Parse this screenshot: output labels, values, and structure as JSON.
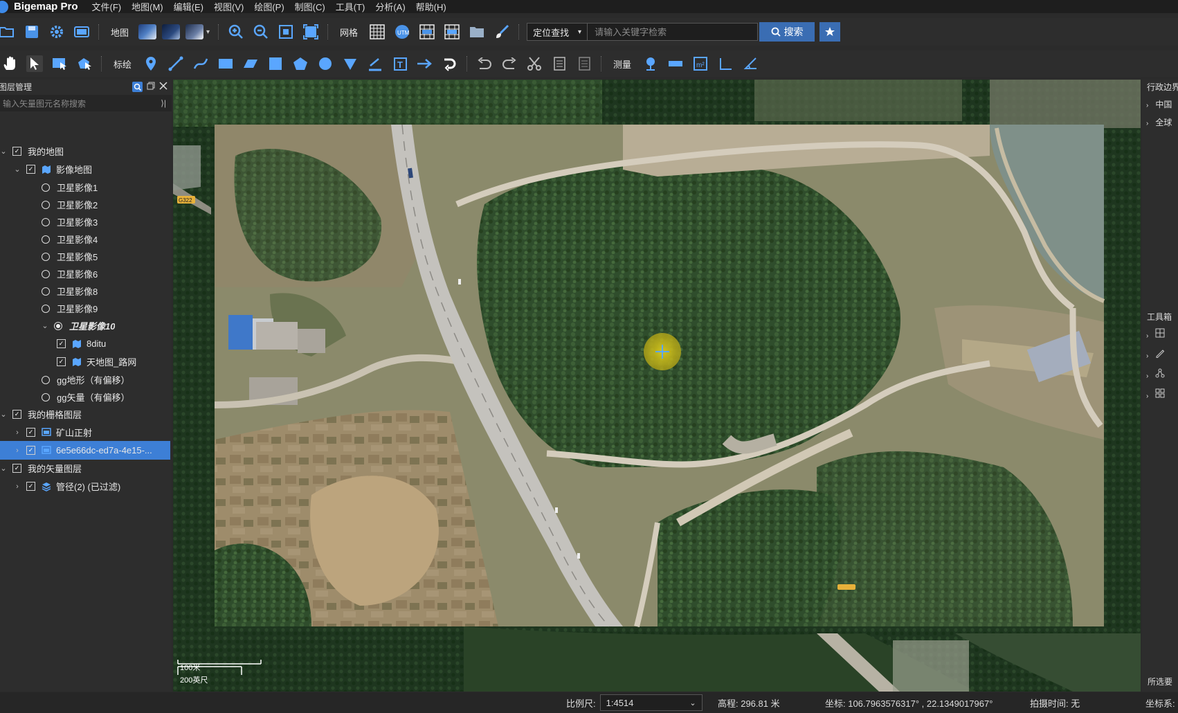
{
  "app": {
    "title": "Bigemap Pro"
  },
  "menu": [
    "文件(F)",
    "地图(M)",
    "编辑(E)",
    "视图(V)",
    "绘图(P)",
    "制图(C)",
    "工具(T)",
    "分析(A)",
    "帮助(H)"
  ],
  "toolbar1": {
    "map_label": "地图",
    "grid_label": "网格",
    "locate_option": "定位查找",
    "search_placeholder": "请输入关键字检索",
    "search_label": "搜索"
  },
  "toolbar2": {
    "annotate_label": "标绘",
    "measure_label": "测量"
  },
  "layer_panel": {
    "title": "图层管理",
    "search_placeholder": "输入矢量图元名称搜索",
    "items": [
      {
        "label": "我的地图",
        "type": "check",
        "checked": true,
        "expanded": true,
        "level": 0
      },
      {
        "label": "影像地图",
        "type": "check",
        "checked": true,
        "expanded": true,
        "level": 1,
        "icon": "map-icon"
      },
      {
        "label": "卫星影像1",
        "type": "radio",
        "checked": false,
        "level": 2
      },
      {
        "label": "卫星影像2",
        "type": "radio",
        "checked": false,
        "level": 2
      },
      {
        "label": "卫星影像3",
        "type": "radio",
        "checked": false,
        "level": 2
      },
      {
        "label": "卫星影像4",
        "type": "radio",
        "checked": false,
        "level": 2
      },
      {
        "label": "卫星影像5",
        "type": "radio",
        "checked": false,
        "level": 2
      },
      {
        "label": "卫星影像6",
        "type": "radio",
        "checked": false,
        "level": 2
      },
      {
        "label": "卫星影像8",
        "type": "radio",
        "checked": false,
        "level": 2
      },
      {
        "label": "卫星影像9",
        "type": "radio",
        "checked": false,
        "level": 2
      },
      {
        "label": "卫星影像10",
        "type": "radio",
        "checked": true,
        "expanded": true,
        "level": 2
      },
      {
        "label": "8ditu",
        "type": "check",
        "checked": true,
        "level": 3,
        "icon": "map-icon"
      },
      {
        "label": "天地图_路网",
        "type": "check",
        "checked": true,
        "level": 3,
        "icon": "map-icon"
      },
      {
        "label": "gg地形（有偏移）",
        "type": "radio",
        "checked": false,
        "level": 2
      },
      {
        "label": "gg矢量（有偏移）",
        "type": "radio",
        "checked": false,
        "level": 2
      },
      {
        "label": "我的栅格图层",
        "type": "check",
        "checked": true,
        "expanded": true,
        "level": 0
      },
      {
        "label": "矿山正射",
        "type": "check",
        "checked": true,
        "expanded": false,
        "level": 1,
        "icon": "raster-icon"
      },
      {
        "label": "6e5e66dc-ed7a-4e15-...",
        "type": "check",
        "checked": true,
        "expanded": false,
        "level": 1,
        "icon": "raster-icon",
        "selected": true
      },
      {
        "label": "我的矢量图层",
        "type": "check",
        "checked": true,
        "expanded": true,
        "level": 0
      },
      {
        "label": "管径(2) (已过滤)",
        "type": "check",
        "checked": true,
        "expanded": false,
        "level": 1,
        "icon": "layers-icon"
      }
    ]
  },
  "map": {
    "road_badge": "G322",
    "road_badge2": "G322",
    "scale_metric": "100米",
    "scale_imperial": "200英尺"
  },
  "right_panel": {
    "admin_title": "行政边界",
    "admin_items": [
      "中国",
      "全球"
    ],
    "toolbox_title": "工具箱",
    "bottom_label": "所选要"
  },
  "status": {
    "scale_label": "比例尺:",
    "scale_value": "1:4514",
    "elevation": "高程: 296.81 米",
    "coordinates": "坐标: 106.7963576317° , 22.1349017967°",
    "capture_time": "拍摄时间: 无",
    "crs_label": "坐标系:"
  },
  "colors": {
    "accent": "#3a6db3",
    "selection": "#3d7fd6",
    "panel": "#2d2d2d"
  }
}
